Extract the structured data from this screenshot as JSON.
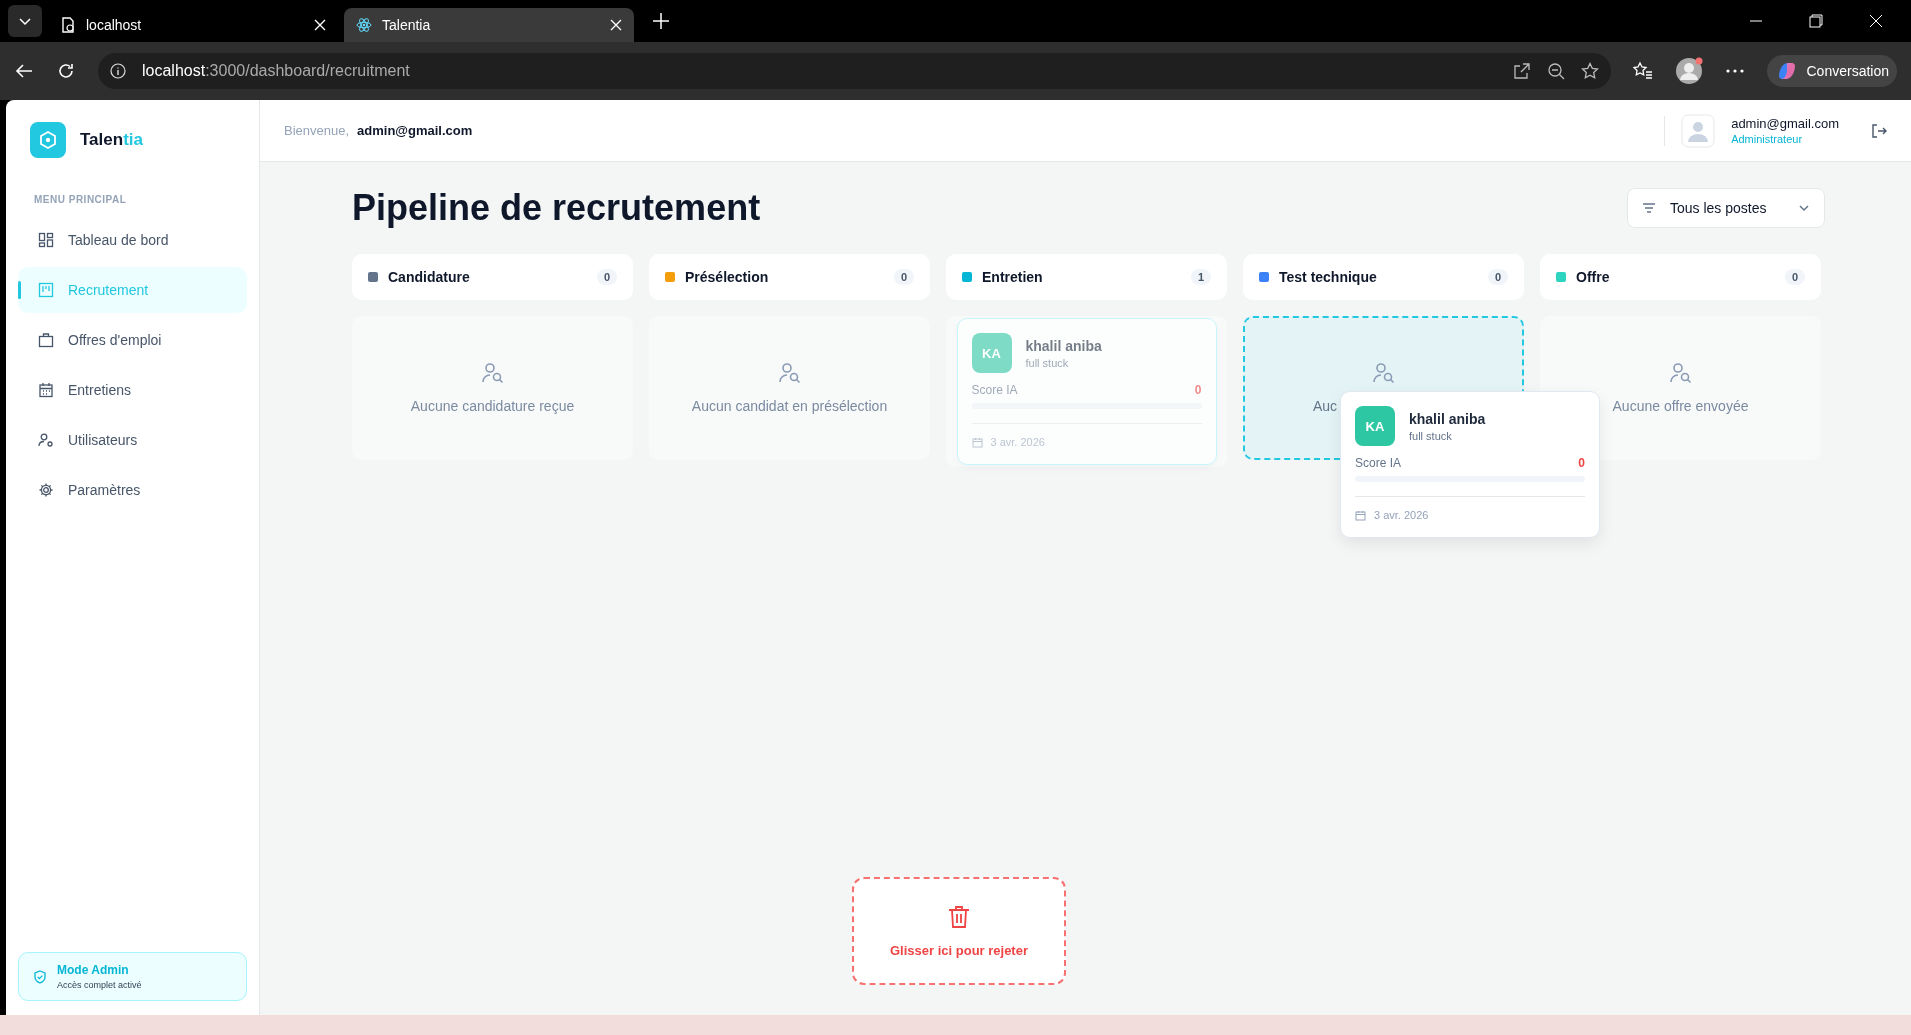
{
  "browser": {
    "tabs": [
      {
        "title": "localhost",
        "selected": false
      },
      {
        "title": "Talentia",
        "selected": true
      }
    ],
    "url": {
      "host": "localhost",
      "path": ":3000/dashboard/recruitment"
    },
    "copilot": "Conversation"
  },
  "sidebar": {
    "brand": {
      "name": "Talen",
      "accent": "tia"
    },
    "section": "MENU PRINCIPAL",
    "items": [
      {
        "label": "Tableau de bord",
        "selected": false
      },
      {
        "label": "Recrutement",
        "selected": true
      },
      {
        "label": "Offres d'emploi",
        "selected": false
      },
      {
        "label": "Entretiens",
        "selected": false
      },
      {
        "label": "Utilisateurs",
        "selected": false
      },
      {
        "label": "Paramètres",
        "selected": false
      }
    ],
    "admin": {
      "title": "Mode Admin",
      "subtitle": "Accès complet activé"
    }
  },
  "header": {
    "greeting": "Bienvenue,",
    "user": "admin@gmail.com",
    "profile": {
      "email": "admin@gmail.com",
      "role": "Administrateur"
    }
  },
  "page": {
    "title": "Pipeline de recrutement",
    "filter": "Tous les postes"
  },
  "columns": [
    {
      "title": "Candidature",
      "count": "0",
      "color": "#64748b",
      "empty_text": "Aucune candidature reçue",
      "drop_target": false
    },
    {
      "title": "Présélection",
      "count": "0",
      "color": "#f59e0b",
      "empty_text": "Aucun candidat en présélection",
      "drop_target": false
    },
    {
      "title": "Entretien",
      "count": "1",
      "color": "#06b6d4",
      "drop_target": false,
      "cards": [
        {
          "initials": "KA",
          "name": "khalil aniba",
          "role": "full stuck",
          "score_label": "Score IA",
          "score": "0",
          "level": 0,
          "date": "3 avr. 2026",
          "dragging": true
        }
      ]
    },
    {
      "title": "Test technique",
      "count": "0",
      "color": "#3b82f6",
      "empty_text": "Auc",
      "drop_target": true
    },
    {
      "title": "Offre",
      "count": "0",
      "color": "#2dd4bf",
      "empty_text": "Aucune offre envoyée",
      "drop_target": false
    }
  ],
  "dragged_card": {
    "initials": "KA",
    "name": "khalil aniba",
    "role": "full stuck",
    "score_label": "Score IA",
    "score": "0",
    "level": 0,
    "date": "3 avr. 2026"
  },
  "reject_zone": {
    "label": "Glisser ici pour rejeter"
  }
}
